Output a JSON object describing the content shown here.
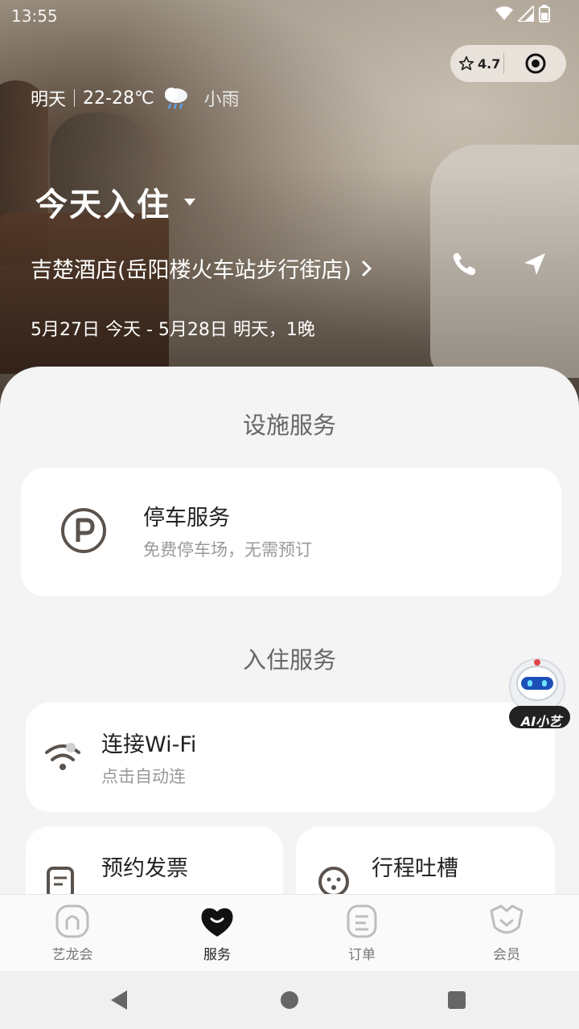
{
  "status_bar": {
    "time": "13:55"
  },
  "capsule": {
    "rating": "4.7",
    "star_icon": "star-outline-icon",
    "target_icon": "target-icon"
  },
  "weather": {
    "day": "明天",
    "temp_range": "22-28℃",
    "condition": "小雨",
    "icon": "cloud-rain-icon"
  },
  "checkin": {
    "title": "今天入住",
    "dropdown_icon": "triangle-down-icon"
  },
  "hotel": {
    "name": "吉楚酒店(岳阳楼火车站步行街店)",
    "chevron_icon": "chevron-right-icon",
    "phone_icon": "phone-icon",
    "navigate_icon": "navigate-arrow-icon"
  },
  "stay": {
    "dates": "5月27日 今天 - 5月28日 明天，1晚"
  },
  "facility": {
    "section_title": "设施服务",
    "parking": {
      "title": "停车服务",
      "subtitle": "免费停车场，无需预订",
      "icon": "parking-icon"
    }
  },
  "checkin_services": {
    "section_title": "入住服务",
    "wifi": {
      "title": "连接Wi-Fi",
      "subtitle": "点击自动连",
      "icon": "wifi-icon"
    },
    "invoice": {
      "title": "预约发票",
      "icon": "invoice-icon"
    },
    "feedback": {
      "title": "行程吐槽",
      "icon": "feedback-face-icon"
    }
  },
  "ai_assistant": {
    "label": "AI小艺"
  },
  "tabbar": {
    "tabs": [
      {
        "label": "艺龙会",
        "icon": "home-arch-icon",
        "active": false
      },
      {
        "label": "服务",
        "icon": "heart-smile-icon",
        "active": true
      },
      {
        "label": "订单",
        "icon": "order-list-icon",
        "active": false
      },
      {
        "label": "会员",
        "icon": "member-shield-icon",
        "active": false
      }
    ]
  },
  "colors": {
    "accent": "#222222",
    "muted": "#999999",
    "background": "#f4f4f4"
  }
}
